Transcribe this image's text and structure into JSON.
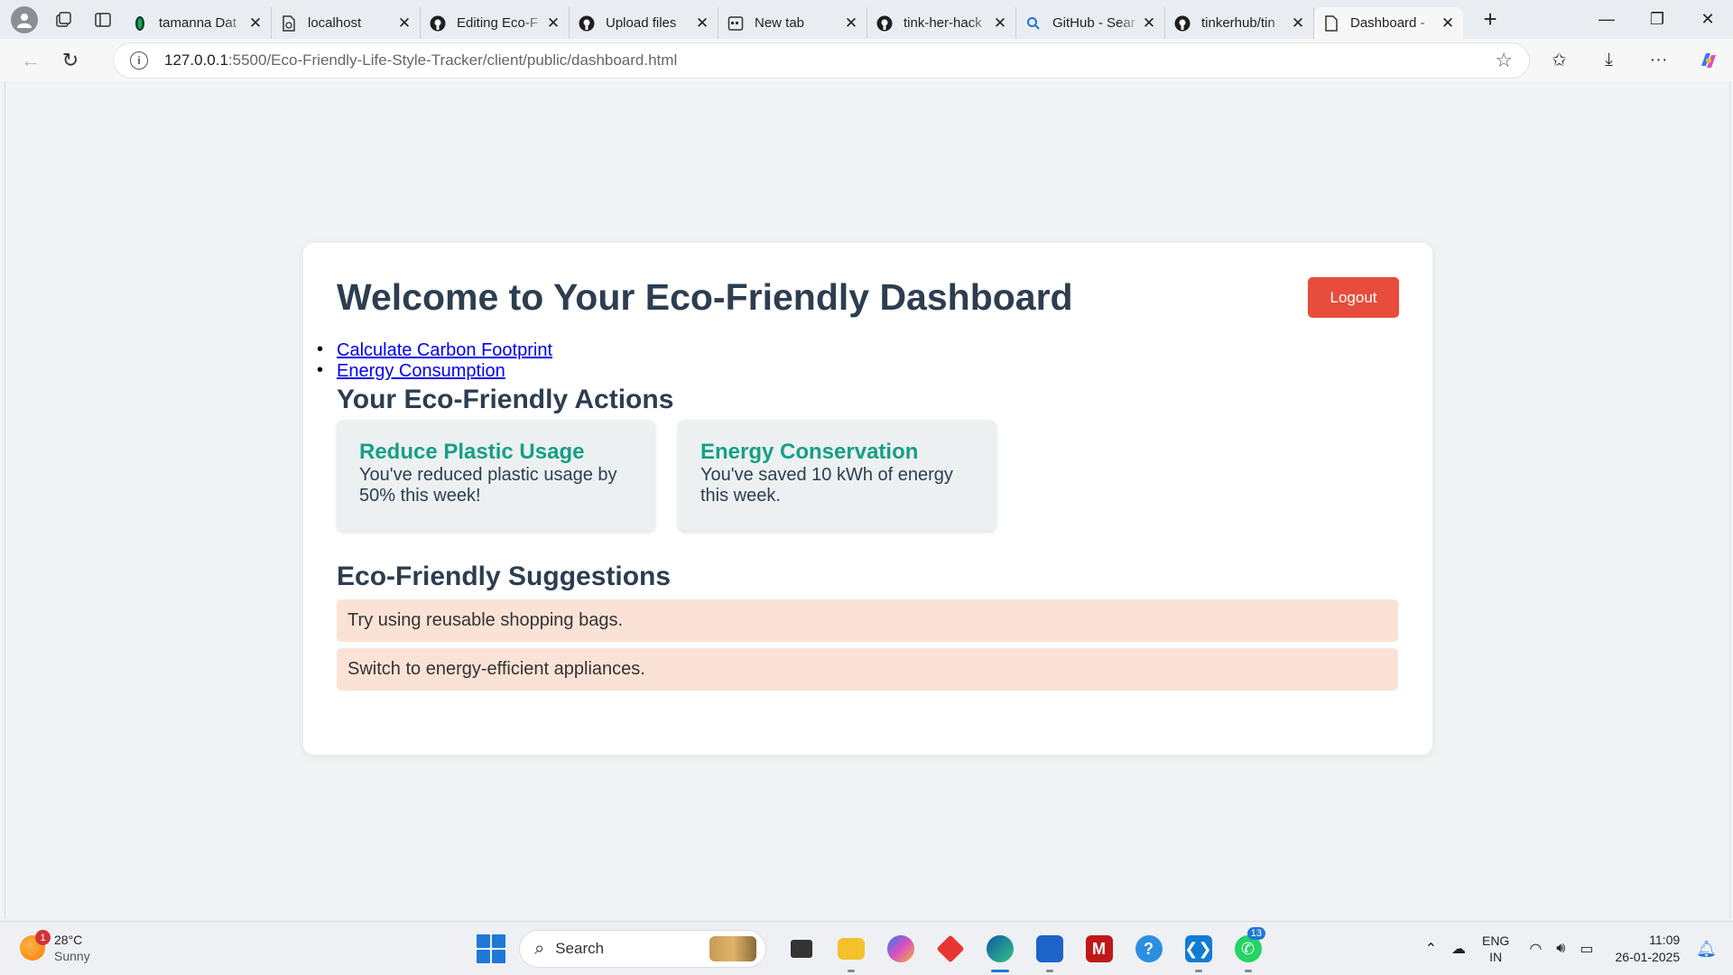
{
  "browser": {
    "tabs": [
      {
        "title": "tamanna Dat",
        "icon": "mongodb-leaf-icon"
      },
      {
        "title": "localhost",
        "icon": "page-sync-icon"
      },
      {
        "title": "Editing Eco-F",
        "icon": "github-icon"
      },
      {
        "title": "Upload files",
        "icon": "github-icon"
      },
      {
        "title": "New tab",
        "icon": "newtab-icon"
      },
      {
        "title": "tink-her-hack",
        "icon": "github-icon"
      },
      {
        "title": "GitHub - Sear",
        "icon": "search-icon"
      },
      {
        "title": "tinkerhub/tin",
        "icon": "github-icon"
      },
      {
        "title": "Dashboard -",
        "icon": "page-icon",
        "active": true
      }
    ],
    "url_host": "127.0.0.1",
    "url_rest": ":5500/Eco-Friendly-Life-Style-Tracker/client/public/dashboard.html"
  },
  "page": {
    "title": "Welcome to Your Eco-Friendly Dashboard",
    "logout_label": "Logout",
    "links": [
      "Calculate Carbon Footprint",
      "Energy Consumption"
    ],
    "actions_heading": "Your Eco-Friendly Actions",
    "actions": [
      {
        "title": "Reduce Plastic Usage",
        "text": "You've reduced plastic usage by 50% this week!"
      },
      {
        "title": "Energy Conservation",
        "text": "You've saved 10 kWh of energy this week."
      }
    ],
    "suggestions_heading": "Eco-Friendly Suggestions",
    "suggestions": [
      "Try using reusable shopping bags.",
      "Switch to energy-efficient appliances."
    ]
  },
  "taskbar": {
    "weather_temp": "28°C",
    "weather_cond": "Sunny",
    "weather_badge": "1",
    "search_placeholder": "Search",
    "whatsapp_badge": "13",
    "lang_top": "ENG",
    "lang_bottom": "IN",
    "time": "11:09",
    "date": "26-01-2025"
  },
  "colors": {
    "heading": "#2c3e50",
    "logout_bg": "#e74c3c",
    "action_title": "#16a085",
    "action_bg": "#ecf0f1",
    "suggestion_bg": "#fae3d6",
    "link": "#0000ee"
  }
}
